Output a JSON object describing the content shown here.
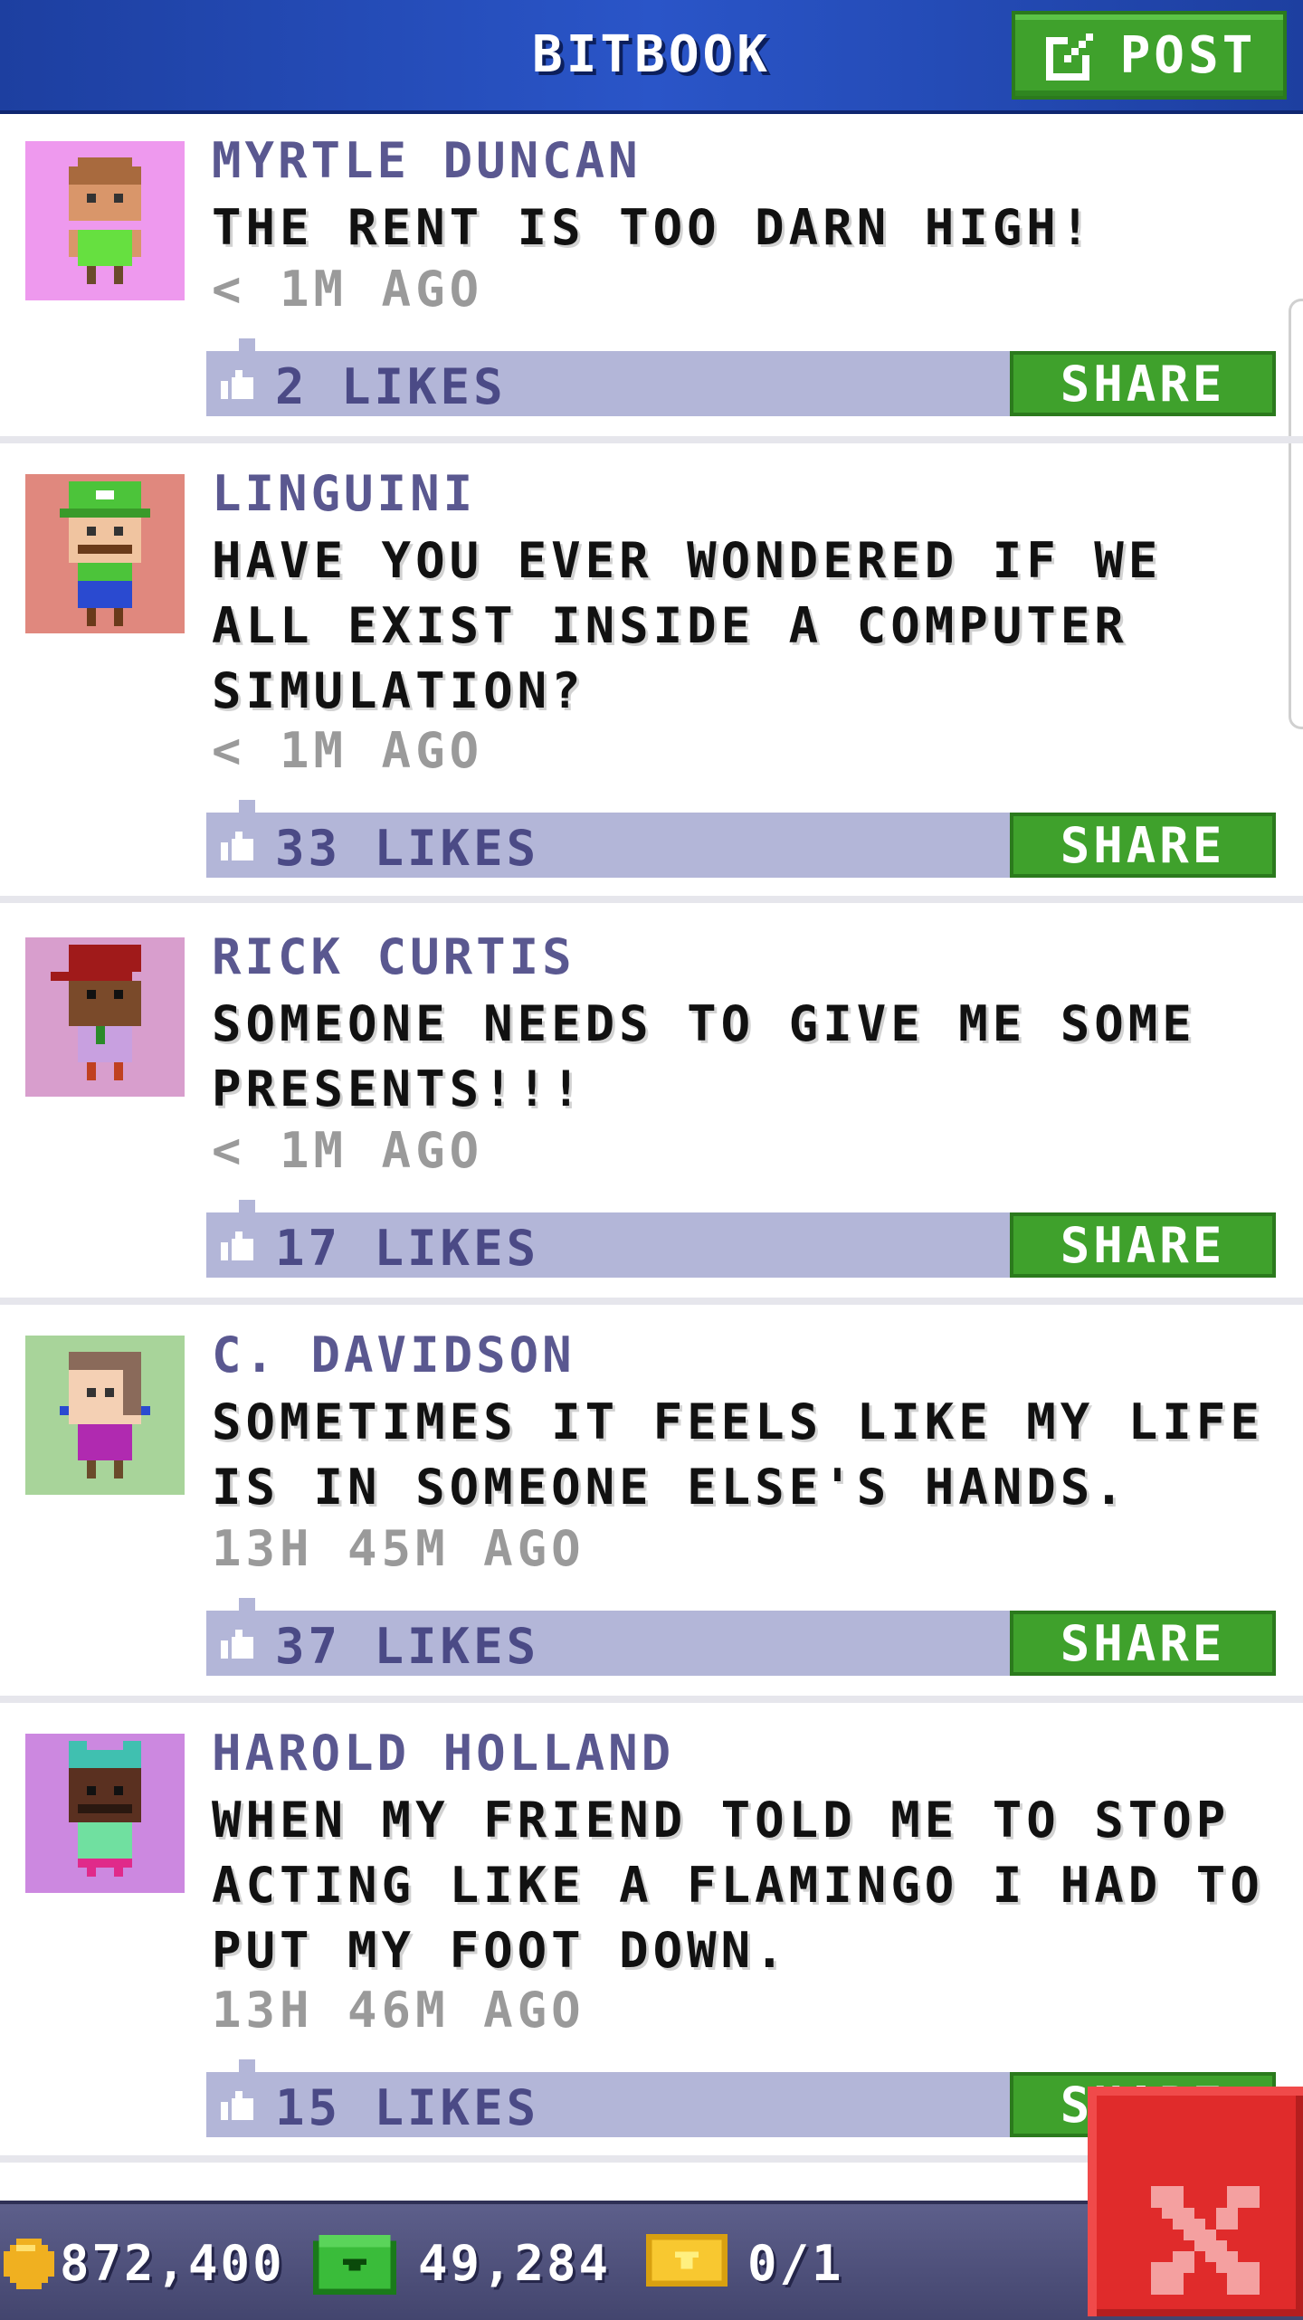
{
  "header": {
    "title": "BITBOOK",
    "post_label": "POST"
  },
  "posts": [
    {
      "author": "MYRTLE DUNCAN",
      "message": "THE RENT IS TOO DARN HIGH!",
      "time": "< 1M AGO",
      "likes": "2 LIKES",
      "share": "SHARE",
      "avatar_bg": "#ee99ee"
    },
    {
      "author": "LINGUINI",
      "message": "HAVE YOU EVER WONDERED IF WE ALL EXIST INSIDE A COMPUTER SIMULATION?",
      "time": "< 1M AGO",
      "likes": "33 LIKES",
      "share": "SHARE",
      "avatar_bg": "#e0887e"
    },
    {
      "author": "RICK CURTIS",
      "message": "SOMEONE NEEDS TO GIVE ME SOME PRESENTS!!!",
      "time": "< 1M AGO",
      "likes": "17 LIKES",
      "share": "SHARE",
      "avatar_bg": "#d89ecd"
    },
    {
      "author": "C. DAVIDSON",
      "message": "SOMETIMES IT FEELS LIKE MY LIFE IS IN SOMEONE ELSE'S HANDS.",
      "time": "13H 45M AGO",
      "likes": "37 LIKES",
      "share": "SHARE",
      "avatar_bg": "#a8d49a"
    },
    {
      "author": "HAROLD HOLLAND",
      "message": "WHEN MY FRIEND TOLD ME TO STOP ACTING LIKE A FLAMINGO I HAD TO PUT MY FOOT DOWN.",
      "time": "13H 46M AGO",
      "likes": "15 LIKES",
      "share": "SHARE",
      "avatar_bg": "#cc88e0"
    }
  ],
  "bottom_bar": {
    "coins": "872,400",
    "bux": "49,284",
    "tickets": "0/1"
  },
  "icons": {
    "post": "compose-icon",
    "like": "thumbs-up-icon",
    "coin": "coin-icon",
    "cash": "cash-icon",
    "ticket": "ticket-icon",
    "close": "close-icon"
  },
  "colors": {
    "header": "#2a55c8",
    "share": "#3fa12c",
    "likes_bar": "#b3b6d8",
    "close": "#e02b2b"
  }
}
